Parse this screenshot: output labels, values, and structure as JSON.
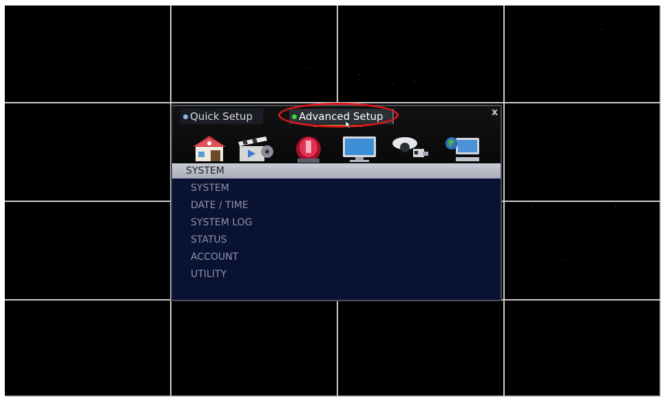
{
  "dialog": {
    "tabs": {
      "quick_setup": "Quick Setup",
      "advanced_setup": "Advanced Setup"
    },
    "close_label": "x",
    "icons": [
      {
        "name": "system-house-icon"
      },
      {
        "name": "record-film-icon"
      },
      {
        "name": "alarm-siren-icon"
      },
      {
        "name": "display-monitor-icon"
      },
      {
        "name": "camera-devices-icon"
      },
      {
        "name": "network-globe-icon"
      }
    ],
    "section_title": "SYSTEM",
    "menu_items": [
      "SYSTEM",
      "DATE / TIME",
      "SYSTEM LOG",
      "STATUS",
      "ACCOUNT",
      "UTILITY"
    ]
  },
  "colors": {
    "active_indicator": "#3adb3a",
    "annotation": "#e0171b",
    "menu_background": "#0a1233"
  }
}
